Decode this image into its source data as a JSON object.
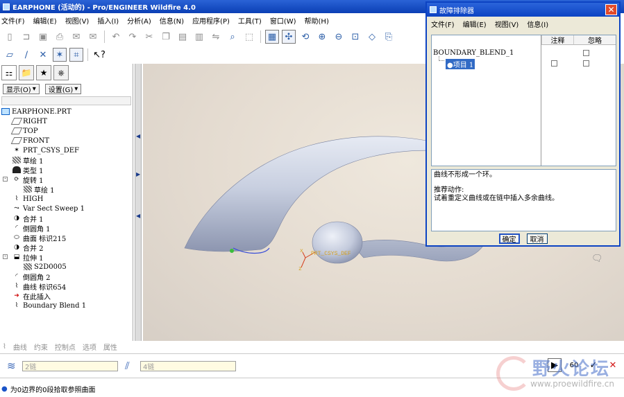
{
  "window": {
    "title": "EARPHONE (活动的) - Pro/ENGINEER Wildfire 4.0"
  },
  "menu": [
    "文件(F)",
    "编辑(E)",
    "视图(V)",
    "插入(I)",
    "分析(A)",
    "信息(N)",
    "应用程序(P)",
    "工具(T)",
    "窗口(W)",
    "帮助(H)"
  ],
  "panel": {
    "show_btn": "显示(O)",
    "settings_btn": "设置(G)",
    "tree": [
      {
        "label": "EARPHONE.PRT",
        "icon": "part-icon",
        "level": 0
      },
      {
        "label": "RIGHT",
        "icon": "datum-plane-icon",
        "level": 1
      },
      {
        "label": "TOP",
        "icon": "datum-plane-icon",
        "level": 1
      },
      {
        "label": "FRONT",
        "icon": "datum-plane-icon",
        "level": 1
      },
      {
        "label": "PRT_CSYS_DEF",
        "icon": "csys-icon",
        "level": 1
      },
      {
        "label": "草绘 1",
        "icon": "sketch-icon",
        "level": 1
      },
      {
        "label": "类型 1",
        "icon": "solid-icon",
        "level": 1
      },
      {
        "label": "旋转 1",
        "icon": "revolve-icon",
        "level": 1,
        "expand": "-"
      },
      {
        "label": "草绘 1",
        "icon": "sketch-icon",
        "level": 2
      },
      {
        "label": "HIGH",
        "icon": "curve-icon",
        "level": 1
      },
      {
        "label": "Var Sect Sweep 1",
        "icon": "sweep-icon",
        "level": 1
      },
      {
        "label": "合并 1",
        "icon": "merge-icon",
        "level": 1
      },
      {
        "label": "倒圆角 1",
        "icon": "round-icon",
        "level": 1
      },
      {
        "label": "曲面 标识215",
        "icon": "surface-icon",
        "level": 1
      },
      {
        "label": "合并 2",
        "icon": "merge-icon",
        "level": 1
      },
      {
        "label": "拉伸 1",
        "icon": "extrude-icon",
        "level": 1,
        "expand": "-"
      },
      {
        "label": "S2D0005",
        "icon": "sketch-icon",
        "level": 2
      },
      {
        "label": "倒圆角 2",
        "icon": "round-icon",
        "level": 1
      },
      {
        "label": "曲线 标识654",
        "icon": "curve-icon",
        "level": 1
      },
      {
        "label": "在此插入",
        "icon": "insert-here-icon",
        "level": 1
      },
      {
        "label": "Boundary Blend 1",
        "icon": "boundary-blend-icon",
        "level": 1
      }
    ]
  },
  "viewport": {
    "csys_label": "PRT_CSYS_DEF"
  },
  "dashboard": {
    "tabs": [
      "曲线",
      "约束",
      "控制点",
      "选项",
      "属性"
    ],
    "field1": "2链",
    "field2": "4链",
    "num": "60"
  },
  "status": {
    "message": "为0边界的0段拾取参照曲面"
  },
  "watermark": {
    "cn": "野火论坛",
    "url": "www.proewildfire.cn"
  },
  "dialog": {
    "title": "故障排除器",
    "menu": [
      "文件(F)",
      "编辑(E)",
      "视图(V)",
      "信息(I)"
    ],
    "col_note": "注释",
    "col_ignore": "忽略",
    "item_parent": "BOUNDARY_BLEND_1",
    "item_child": "项目 1",
    "msg_line1": "曲线不形成一个环。",
    "msg_line2": "推荐动作:",
    "msg_line3": "试着重定义曲线或在链中插入多余曲线。",
    "ok": "确定",
    "cancel": "取消"
  }
}
